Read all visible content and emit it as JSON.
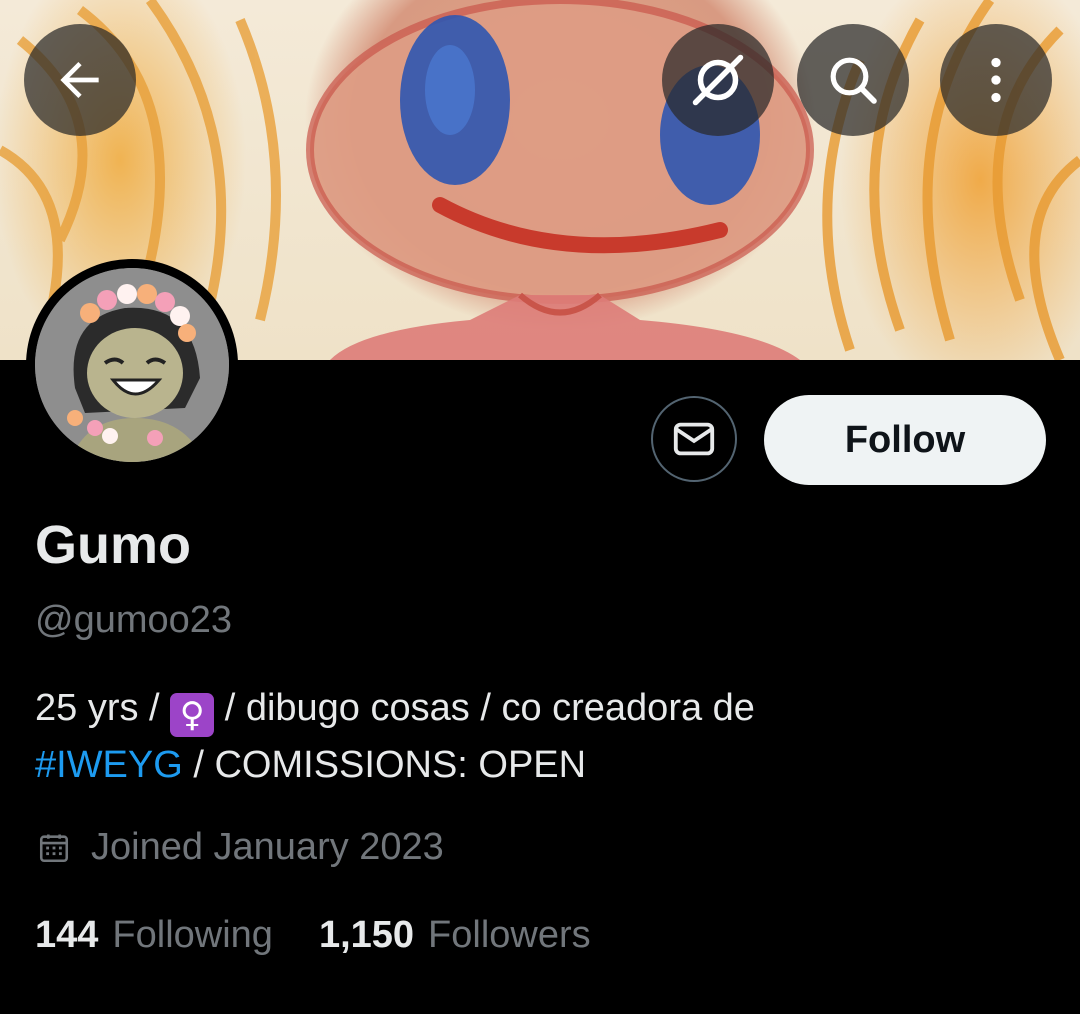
{
  "header": {
    "back_icon": "arrow-left-icon",
    "grok_icon": "grok-icon",
    "search_icon": "search-icon",
    "more_icon": "more-vertical-icon"
  },
  "profile": {
    "display_name": "Gumo",
    "handle": "@gumoo23",
    "bio_part1": "25 yrs / ",
    "bio_emoji": "♀",
    "bio_part2": " / dibugo cosas / co creadora de ",
    "bio_hashtag": "#IWEYG",
    "bio_part3": " / COMISSIONS: OPEN",
    "joined": "Joined January 2023",
    "following_count": "144",
    "following_label": "Following",
    "followers_count": "1,150",
    "followers_label": "Followers"
  },
  "actions": {
    "message_icon": "envelope-icon",
    "follow_label": "Follow"
  },
  "colors": {
    "background": "#000000",
    "hashtag": "#1d9bf0",
    "secondary_text": "#71767b",
    "follow_button_bg": "#eff3f4"
  }
}
